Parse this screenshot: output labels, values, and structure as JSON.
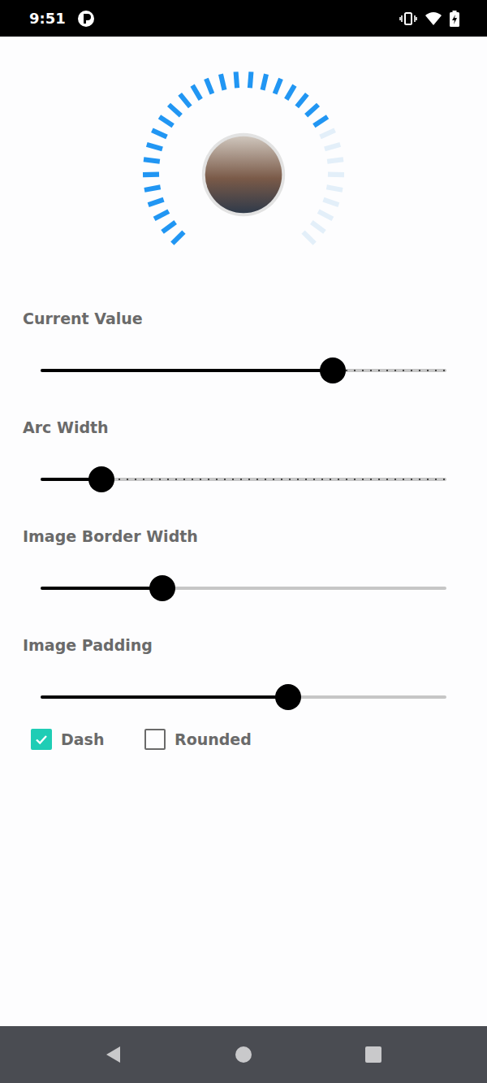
{
  "status_bar": {
    "time": "9:51"
  },
  "sliders": [
    {
      "label": "Current Value",
      "level": 0.72,
      "discrete": true
    },
    {
      "label": "Arc Width",
      "level": 0.15,
      "discrete": true
    },
    {
      "label": "Image Border Width",
      "level": 0.3,
      "discrete": false
    },
    {
      "label": "Image Padding",
      "level": 0.61,
      "discrete": false
    }
  ],
  "options": [
    {
      "label": "Dash",
      "checked": true
    },
    {
      "label": "Rounded",
      "checked": false
    }
  ]
}
